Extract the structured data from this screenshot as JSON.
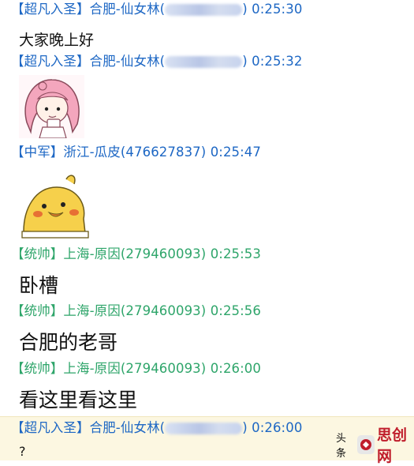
{
  "messages": [
    {
      "badge": "【超凡入圣】",
      "sender": "合肥-仙女林(",
      "sender_end": ")",
      "time": "0:25:30",
      "text": "大家晚上好",
      "redacted": true
    },
    {
      "badge": "【超凡入圣】",
      "sender": "合肥-仙女林(",
      "sender_end": ")",
      "time": "0:25:32",
      "sticker": "pink-hair-girl-sticker",
      "redacted": true
    },
    {
      "badge": "【中军】",
      "sender": "浙江-瓜皮(476627837)",
      "time": "0:25:47",
      "sticker": "yellow-duck-sticker"
    },
    {
      "badge": "【统帅】",
      "sender": "上海-原因(279460093)",
      "time": "0:25:53",
      "text": "卧槽"
    },
    {
      "badge": "【统帅】",
      "sender": "上海-原因(279460093)",
      "time": "0:25:56",
      "text": "合肥的老哥"
    },
    {
      "badge": "【统帅】",
      "sender": "上海-原因(279460093)",
      "time": "0:26:00",
      "text": "看这里看这里"
    },
    {
      "badge": "【超凡入圣】",
      "sender": "合肥-仙女林(",
      "sender_end": ")",
      "time": "0:26:00",
      "text": "?",
      "redacted": true
    }
  ],
  "watermark": {
    "source": "头条",
    "site": "思创网"
  },
  "colors": {
    "blue_header": "#1d67c4",
    "green_header": "#2ea56a",
    "highlight": "#fcf7e1"
  }
}
